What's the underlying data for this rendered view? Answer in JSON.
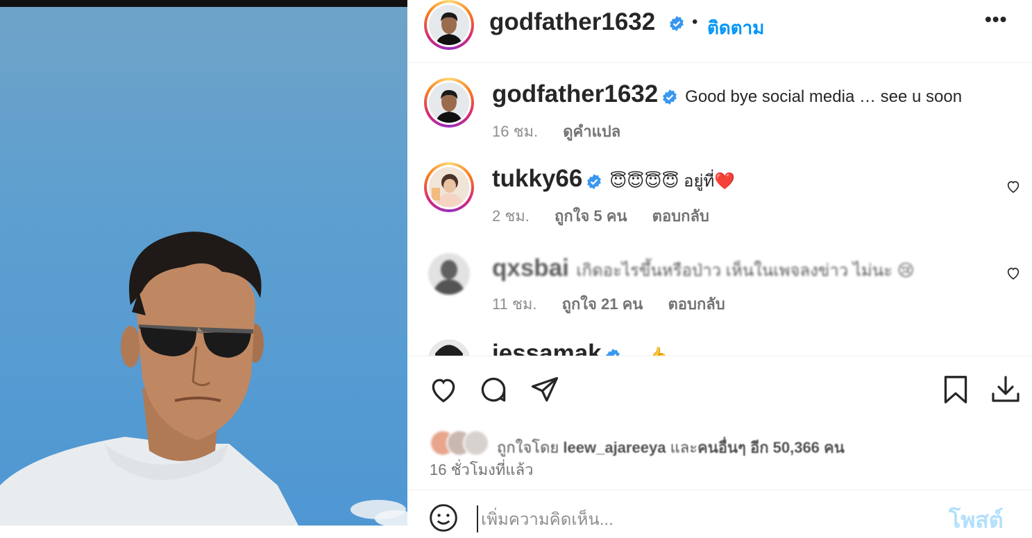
{
  "post": {
    "author": "godfather1632",
    "follow_label": "ติดตาม",
    "dot": "•",
    "more_label": "•••"
  },
  "caption": {
    "author": "godfather1632",
    "text": "Good bye social media … see u soon",
    "time": "16 ชม.",
    "translate": "ดูคำแปล"
  },
  "comments": [
    {
      "author": "tukky66",
      "verified": true,
      "text": "😇😇😇😇 อยู่ที่❤️",
      "time": "2 ชม.",
      "likes": "ถูกใจ 5 คน",
      "reply": "ตอบกลับ"
    },
    {
      "author": "qxsbai",
      "verified": false,
      "text": "เกิดอะไรขึ้นหรือป่าว เห็นในเพจลงข่าว ไม่นะ 😢",
      "time": "11 ชม.",
      "likes": "ถูกใจ 21 คน",
      "reply": "ตอบกลับ"
    },
    {
      "author": "jessamak",
      "verified": true,
      "text": "... 👍"
    }
  ],
  "actions": {
    "liked_by_prefix": "ถูกใจโดย",
    "liked_by_user": "leew_ajareeya",
    "liked_by_and": "และ",
    "liked_by_others": "คนอื่นๆ อีก 50,366 คน",
    "time_ago": "16 ชั่วโมงที่แล้ว",
    "add_comment_placeholder": "เพิ่มความคิดเห็น...",
    "post_button": "โพสต์"
  },
  "colors": {
    "accent": "#0095f6",
    "verified": "#3897f0",
    "heart_red": "#ed4956",
    "muted": "#8e8e8e"
  },
  "icons": [
    "heart-icon",
    "comment-icon",
    "share-icon",
    "bookmark-icon",
    "download-icon",
    "emoji-icon",
    "verified-icon",
    "more-icon"
  ]
}
